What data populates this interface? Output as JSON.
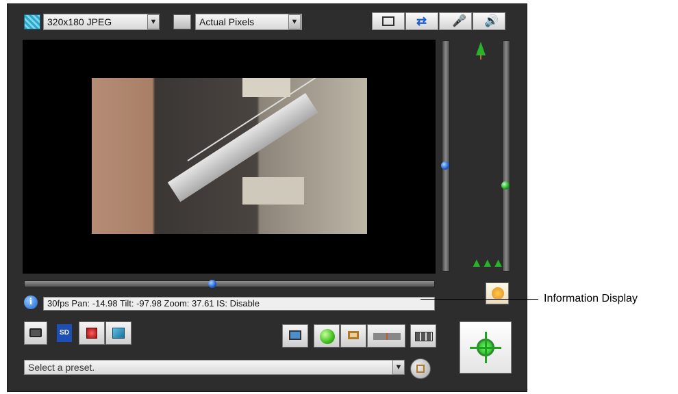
{
  "toolbar": {
    "resolution": "320x180 JPEG",
    "display_size": "Actual Pixels",
    "icons": [
      "fullscreen-icon",
      "swap-icon",
      "microphone-icon",
      "speaker-icon"
    ]
  },
  "info": {
    "text": "30fps Pan: -14.98 Tilt: -97.98 Zoom: 37.61 IS: Disable"
  },
  "preset": {
    "placeholder": "Select a preset."
  },
  "callout": {
    "label": "Information Display"
  },
  "colors": {
    "panel": "#2d2d2d",
    "accent_blue": "#1d5fd0",
    "accent_green": "#1fa31f"
  },
  "controls": {
    "pan_fraction": 0.46,
    "tilt_fraction": 0.5,
    "zoom_fraction": 0.69
  }
}
